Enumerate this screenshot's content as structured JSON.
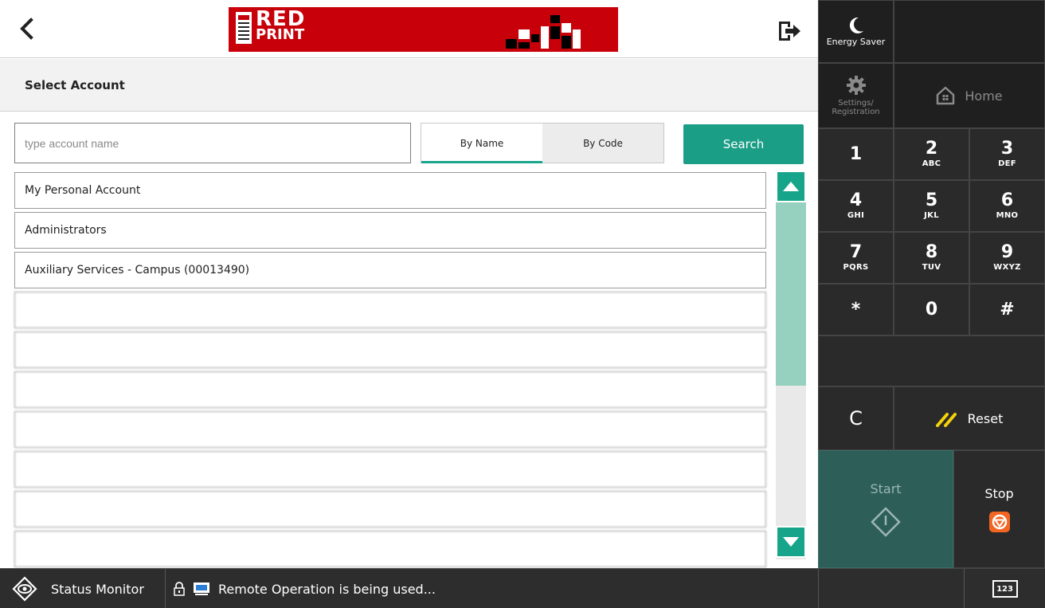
{
  "topbar": {
    "banner": {
      "text_main": "RED",
      "text_sub": "PRINT"
    }
  },
  "header": {
    "title": "Select Account"
  },
  "search": {
    "placeholder": "type account name",
    "mode_tabs": [
      {
        "label": "By Name",
        "active": true
      },
      {
        "label": "By Code",
        "active": false
      }
    ],
    "button_label": "Search"
  },
  "accounts": {
    "items": [
      {
        "label": "My Personal Account"
      },
      {
        "label": "Administrators"
      },
      {
        "label": "Auxiliary Services - Campus (00013490)"
      },
      {
        "label": ""
      },
      {
        "label": ""
      },
      {
        "label": ""
      },
      {
        "label": ""
      },
      {
        "label": ""
      },
      {
        "label": ""
      },
      {
        "label": ""
      }
    ]
  },
  "panel": {
    "energy_saver_label": "Energy Saver",
    "settings_label": "Settings/ Registration",
    "home_label": "Home",
    "keys": [
      {
        "digit": "1",
        "letters": ""
      },
      {
        "digit": "2",
        "letters": "ABC"
      },
      {
        "digit": "3",
        "letters": "DEF"
      },
      {
        "digit": "4",
        "letters": "GHI"
      },
      {
        "digit": "5",
        "letters": "JKL"
      },
      {
        "digit": "6",
        "letters": "MNO"
      },
      {
        "digit": "7",
        "letters": "PQRS"
      },
      {
        "digit": "8",
        "letters": "TUV"
      },
      {
        "digit": "9",
        "letters": "WXYZ"
      },
      {
        "digit": "*",
        "letters": ""
      },
      {
        "digit": "0",
        "letters": ""
      },
      {
        "digit": "#",
        "letters": ""
      }
    ],
    "clear_label": "C",
    "reset_label": "Reset",
    "start_label": "Start",
    "stop_label": "Stop"
  },
  "statusbar": {
    "monitor_label": "Status Monitor",
    "message": "Remote Operation is being used...",
    "keyboard_label": "123"
  },
  "colors": {
    "accent": "#1a9e86",
    "banner": "#c8000a",
    "stop": "#f26522"
  }
}
